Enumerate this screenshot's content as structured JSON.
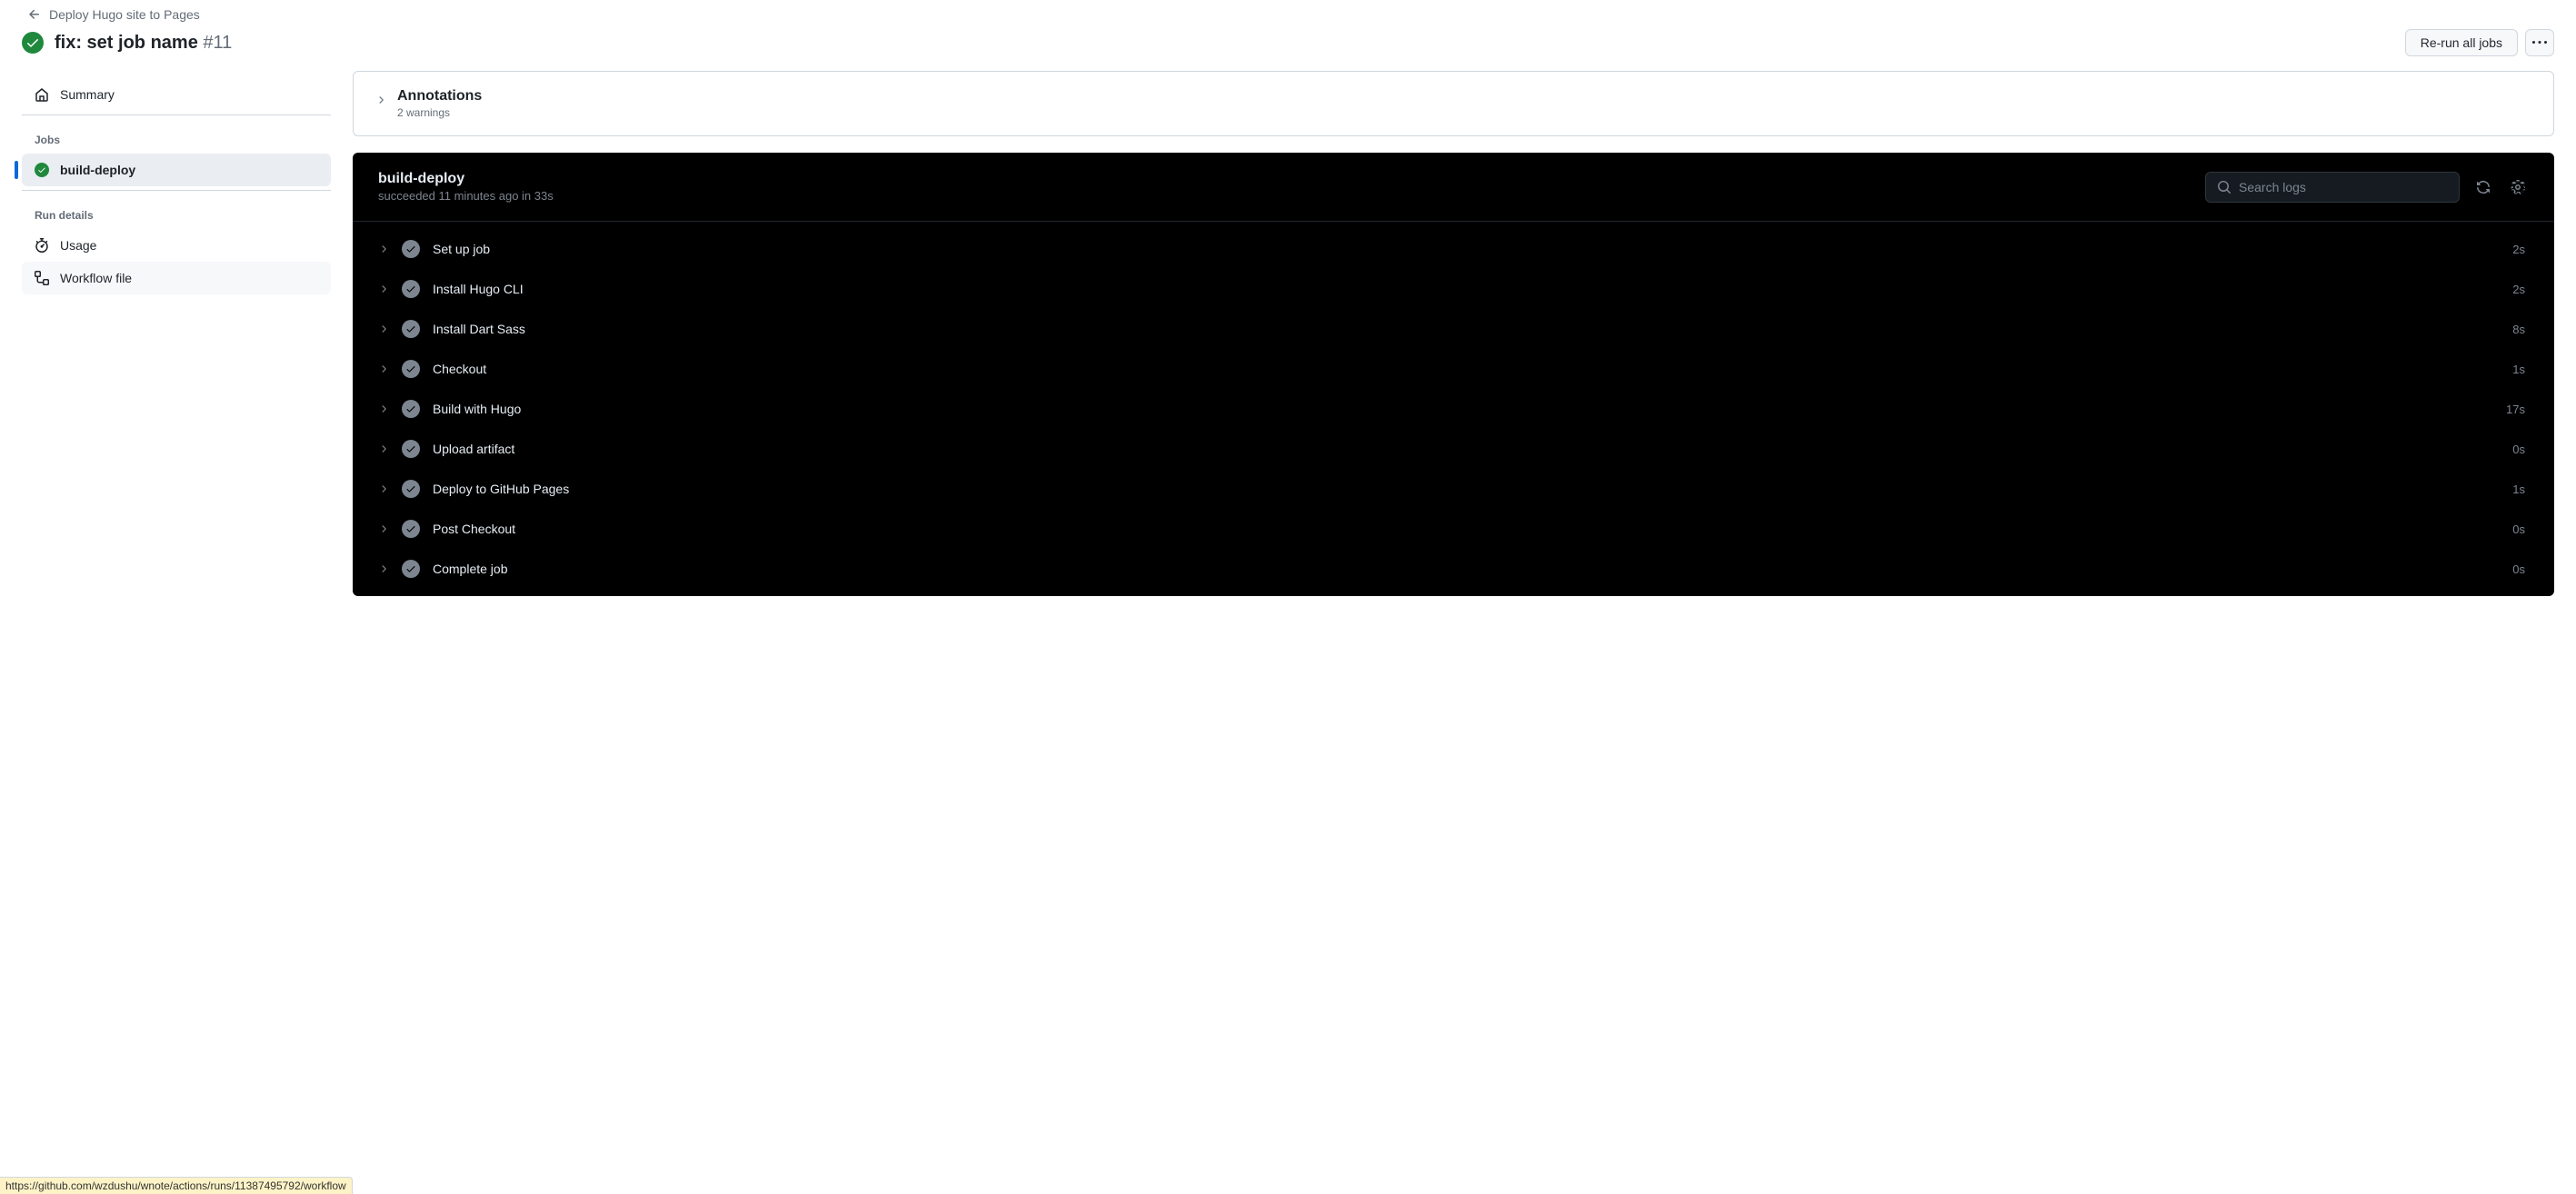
{
  "backlink": "Deploy Hugo site to Pages",
  "title": "fix: set job name",
  "run_number": "#11",
  "rerun_label": "Re-run all jobs",
  "sidebar": {
    "summary": "Summary",
    "jobs_header": "Jobs",
    "job": "build-deploy",
    "run_details_header": "Run details",
    "usage": "Usage",
    "workflow_file": "Workflow file"
  },
  "annotations": {
    "title": "Annotations",
    "subtitle": "2 warnings"
  },
  "log": {
    "title": "build-deploy",
    "subtitle": "succeeded 11 minutes ago in 33s",
    "search_placeholder": "Search logs",
    "steps": [
      {
        "name": "Set up job",
        "duration": "2s"
      },
      {
        "name": "Install Hugo CLI",
        "duration": "2s"
      },
      {
        "name": "Install Dart Sass",
        "duration": "8s"
      },
      {
        "name": "Checkout",
        "duration": "1s"
      },
      {
        "name": "Build with Hugo",
        "duration": "17s"
      },
      {
        "name": "Upload artifact",
        "duration": "0s"
      },
      {
        "name": "Deploy to GitHub Pages",
        "duration": "1s"
      },
      {
        "name": "Post Checkout",
        "duration": "0s"
      },
      {
        "name": "Complete job",
        "duration": "0s"
      }
    ]
  },
  "status_url": "https://github.com/wzdushu/wnote/actions/runs/11387495792/workflow"
}
